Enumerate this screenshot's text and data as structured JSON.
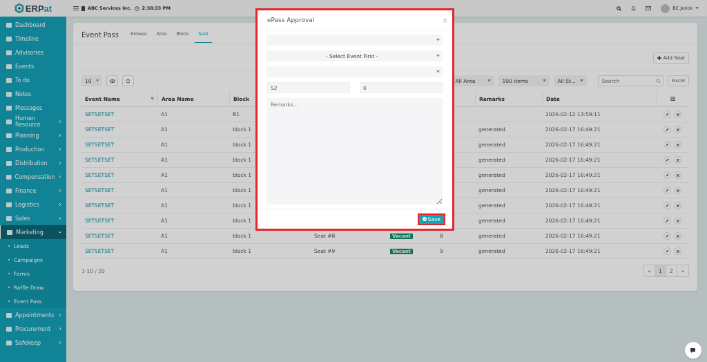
{
  "brand": {
    "prefix": "ERP",
    "suffix": "at"
  },
  "topbar": {
    "company": "ABC Services Inc.",
    "time": "2:38:33 PM",
    "user": "BC Jerick"
  },
  "sidebar": {
    "items": [
      {
        "label": "Dashboard",
        "has_children": false
      },
      {
        "label": "Timeline",
        "has_children": false
      },
      {
        "label": "Advisories",
        "has_children": false
      },
      {
        "label": "Events",
        "has_children": false
      },
      {
        "label": "To do",
        "has_children": false
      },
      {
        "label": "Notes",
        "has_children": false
      },
      {
        "label": "Messages",
        "has_children": false
      },
      {
        "label": "Human Resource",
        "has_children": true,
        "expanded": false,
        "selected": false
      },
      {
        "label": "Planning",
        "has_children": true,
        "expanded": false,
        "selected": false
      },
      {
        "label": "Production",
        "has_children": true,
        "expanded": false,
        "selected": false
      },
      {
        "label": "Distribution",
        "has_children": true,
        "expanded": false,
        "selected": false
      },
      {
        "label": "Compensation",
        "has_children": true,
        "expanded": false,
        "selected": false
      },
      {
        "label": "Finance",
        "has_children": true,
        "expanded": false,
        "selected": false
      },
      {
        "label": "Logistics",
        "has_children": true,
        "expanded": false,
        "selected": false
      },
      {
        "label": "Sales",
        "has_children": true,
        "expanded": false,
        "selected": false
      },
      {
        "label": "Marketing",
        "has_children": true,
        "expanded": true,
        "selected": true,
        "children": [
          {
            "label": "Leads"
          },
          {
            "label": "Campaigns"
          },
          {
            "label": "Forms"
          },
          {
            "label": "Raffle Draw"
          },
          {
            "label": "Event Pass"
          }
        ]
      },
      {
        "label": "Appointments",
        "has_children": true,
        "expanded": false,
        "selected": false
      },
      {
        "label": "Procurement",
        "has_children": true,
        "expanded": false,
        "selected": false
      },
      {
        "label": "Safekeep",
        "has_children": true,
        "expanded": false,
        "selected": false
      }
    ]
  },
  "card": {
    "title": "Event Pass",
    "tabs": [
      {
        "label": "Browse",
        "selected": false
      },
      {
        "label": "Area",
        "selected": false
      },
      {
        "label": "Block",
        "selected": false
      },
      {
        "label": "Seat",
        "selected": true
      }
    ],
    "add_button": "Add Seat",
    "page_size": "10",
    "filters": [
      "All Area",
      "100 items",
      "All St..."
    ],
    "search": {
      "placeholder": "Search"
    },
    "export_button": "Excel",
    "table": {
      "columns": [
        "Event Name",
        "Area Name",
        "Block",
        "",
        "",
        "",
        "Remarks",
        "Date"
      ],
      "rows": [
        {
          "event_name": "SETSETSET",
          "area_name": "A1",
          "block": "B1",
          "date": "2026-02-12 13:59:11"
        },
        {
          "event_name": "SETSETSET",
          "area_name": "A1",
          "block": "block 1",
          "remarks": "generated",
          "date": "2026-02-17 16:49:21"
        },
        {
          "event_name": "SETSETSET",
          "area_name": "A1",
          "block": "block 1",
          "remarks": "generated",
          "date": "2026-02-17 16:49:21"
        },
        {
          "event_name": "SETSETSET",
          "area_name": "A1",
          "block": "block 1",
          "remarks": "generated",
          "date": "2026-02-17 16:49:21"
        },
        {
          "event_name": "SETSETSET",
          "area_name": "A1",
          "block": "block 1",
          "remarks": "generated",
          "date": "2026-02-17 16:49:21"
        },
        {
          "event_name": "SETSETSET",
          "area_name": "A1",
          "block": "block 1",
          "remarks": "generated",
          "date": "2026-02-17 16:49:21"
        },
        {
          "event_name": "SETSETSET",
          "area_name": "A1",
          "block": "block 1",
          "remarks": "generated",
          "date": "2026-02-17 16:49:21"
        },
        {
          "event_name": "SETSETSET",
          "area_name": "A1",
          "block": "block 1",
          "remarks": "generated",
          "date": "2026-02-17 16:49:21"
        },
        {
          "event_name": "SETSETSET",
          "area_name": "A1",
          "block": "block 1",
          "seat": "Seat #8",
          "status": "Vacant",
          "number": "8",
          "remarks": "generated",
          "date": "2026-02-17 16:49:21"
        },
        {
          "event_name": "SETSETSET",
          "area_name": "A1",
          "block": "block 1",
          "seat": "Seat #9",
          "status": "Vacant",
          "number": "9",
          "remarks": "generated",
          "date": "2026-02-17 16:49:21"
        }
      ]
    },
    "count": "1-10 / 20",
    "pagination": {
      "prev": "«",
      "next": "»",
      "pages": [
        {
          "label": "1",
          "selected": true
        },
        {
          "label": "2",
          "selected": false
        }
      ]
    }
  },
  "modal": {
    "title": "ePass Approval",
    "close": "×",
    "highlighted": true,
    "selects": [
      {
        "kind": "select"
      },
      {
        "kind": "select",
        "value": "- Select Event First -"
      },
      {
        "kind": "select"
      }
    ],
    "inputs": [
      {
        "value": "S2"
      },
      {
        "value": "0"
      }
    ],
    "remarks": {
      "placeholder": "Remarks..."
    },
    "save_button": {
      "label": "Save",
      "highlighted": true
    }
  }
}
